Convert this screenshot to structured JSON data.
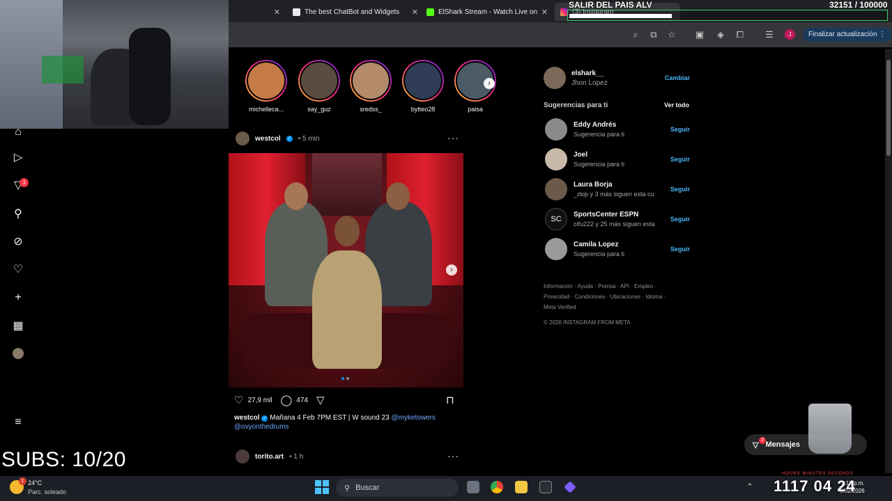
{
  "browser": {
    "tabs": [
      {
        "label": "The best ChatBot and Widgets",
        "close": "✕"
      },
      {
        "label": "ElShark Stream - Watch Live on",
        "close": "✕"
      },
      {
        "label": "(3) Instagram",
        "close": "✕"
      }
    ],
    "update_label": "Finalizar actualización",
    "profile_initial": "J"
  },
  "overlay": {
    "stream_title": "SALIR DEL PAIS ALV",
    "goal_count": "32151 / 100000",
    "goal_progress": 0.32151,
    "subs": "SUBS: 10/20",
    "clock": "1117 04 24",
    "clock_labels": "HOURS   MINUTES   SECONDS"
  },
  "nav": {
    "notifications_badge": "3"
  },
  "stories": [
    {
      "name": "michelleca..."
    },
    {
      "name": "say_guz"
    },
    {
      "name": "sredss_"
    },
    {
      "name": "bytteo28"
    },
    {
      "name": "paisa"
    }
  ],
  "post": {
    "user": "westcol",
    "time": "5 min",
    "likes": "27,9 mil",
    "comments": "474",
    "caption_user": "westcol",
    "caption_text": "Mañana 4 Feb 7PM EST | W sound 23",
    "mention1": "@myketowers",
    "mention2": "@ovyonthedrums"
  },
  "post2": {
    "user": "torito.art",
    "time": "1 h"
  },
  "sidebar": {
    "me_user": "elshark__",
    "me_name": "Jhon Lopez",
    "switch_label": "Cambiar",
    "suggestions_title": "Sugerencias para ti",
    "see_all": "Ver todo",
    "follow_label": "Seguir",
    "suggestions": [
      {
        "name": "Eddy Andrés",
        "sub": "Sugerencia para ti"
      },
      {
        "name": "Joel",
        "sub": "Sugerencia para ti"
      },
      {
        "name": "Laura Borja",
        "sub": "_zkip y 3 más siguen esta cu"
      },
      {
        "name": "SportsCenter ESPN",
        "sub": "cifu222 y 25 más siguen esta"
      },
      {
        "name": "Camila Lopez",
        "sub": "Sugerencia para ti"
      }
    ],
    "footer_line1": "Información · Ayuda · Prensa · API · Empleo ·",
    "footer_line2": "Privacidad · Condiciones · Ubicaciones · Idioma ·",
    "footer_line3": "Meta Verified",
    "copyright": "© 2026 INSTAGRAM FROM META"
  },
  "messages": {
    "label": "Mensajes",
    "badge": "3"
  },
  "taskbar": {
    "weather_temp": "24°C",
    "weather_desc": "Parc. soleado",
    "weather_badge": "1",
    "search_label": "Buscar",
    "time": "2:12 p.m.",
    "date": "3/02/2026",
    "lang": "LAA"
  }
}
